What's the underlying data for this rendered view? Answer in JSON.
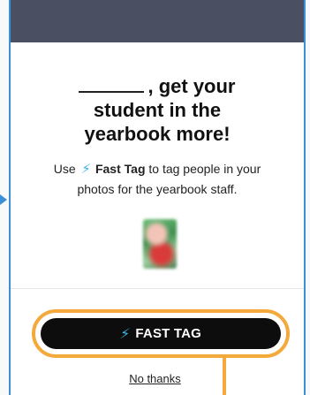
{
  "headline": {
    "line1_suffix": ", get your",
    "line2": "student in the",
    "line3": "yearbook more!"
  },
  "subtext": {
    "prefix": "Use",
    "feature_name": "Fast Tag",
    "middle": "to tag people in your",
    "line2": "photos for the yearbook staff."
  },
  "icons": {
    "lightning": "⚡",
    "lightning_icon_name": "lightning-bolt-icon"
  },
  "cta": {
    "label": "FAST TAG"
  },
  "secondary": {
    "no_thanks": "No thanks"
  },
  "colors": {
    "header_bar": "#4a4f62",
    "modal_border": "#3a8fd6",
    "highlight": "#f4a93c",
    "cta_bg": "#0d0d0d",
    "bolt": "#3bb3e6"
  }
}
